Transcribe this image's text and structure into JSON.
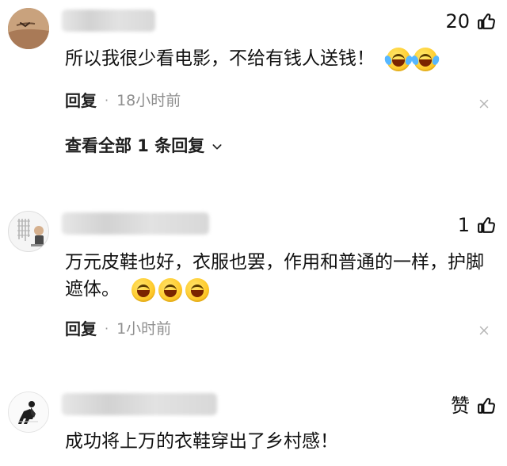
{
  "comments": [
    {
      "likes": "20",
      "text": "所以我很少看电影，不给有钱人送钱！",
      "reply_label": "回复",
      "separator": "·",
      "time": "18小时前",
      "view_all_label": "查看全部 1 条回复"
    },
    {
      "likes": "1",
      "text": "万元皮鞋也好，衣服也罢，作用和普通的一样，护脚遮体。",
      "reply_label": "回复",
      "separator": "·",
      "time": "1小时前"
    },
    {
      "likes": "赞",
      "text": "成功将上万的衣鞋穿出了乡村感！"
    }
  ],
  "icons": {
    "like": "thumb-up-icon",
    "close": "close-icon",
    "chevron": "chevron-down-icon",
    "laugh_tears": "face-with-tears-of-joy-icon",
    "grin": "grinning-face-icon"
  },
  "colors": {
    "text_primary": "#111111",
    "text_secondary": "#8f8f8f",
    "divider": "#e6e6e6",
    "emoji_yellow": "#ffcc2f"
  }
}
